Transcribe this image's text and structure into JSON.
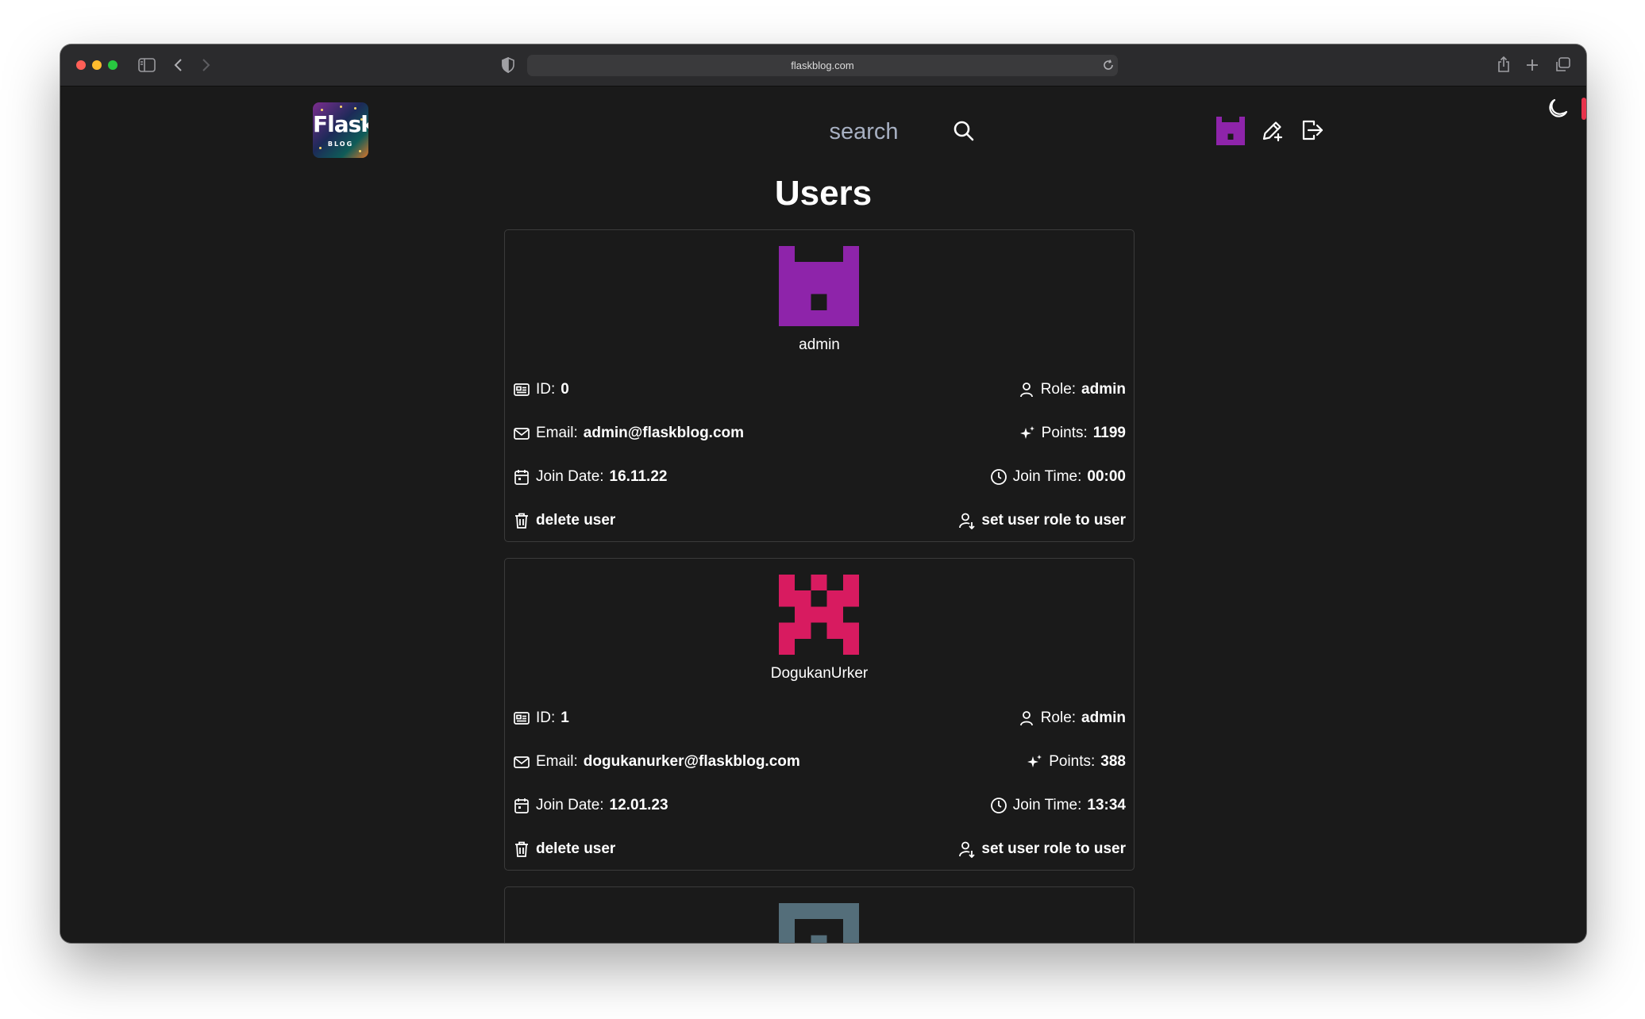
{
  "browser": {
    "url": "flaskblog.com",
    "traffic_lights": [
      "#ff5f57",
      "#febc2e",
      "#28c840"
    ]
  },
  "nav": {
    "logo_text": "Flask",
    "logo_sub": "BLOG",
    "search_placeholder": "search"
  },
  "page": {
    "title": "Users"
  },
  "labels": {
    "id": "ID:",
    "role": "Role:",
    "email": "Email:",
    "points": "Points:",
    "join_date": "Join Date:",
    "join_time": "Join Time:",
    "delete": "delete user",
    "set_role": "set user role to user"
  },
  "users": [
    {
      "name": "admin",
      "id": "0",
      "role": "admin",
      "email": "admin@flaskblog.com",
      "points": "1199",
      "join_date": "16.11.22",
      "join_time": "00:00",
      "avatar_color": "#8e24aa"
    },
    {
      "name": "DogukanUrker",
      "id": "1",
      "role": "admin",
      "email": "dogukanurker@flaskblog.com",
      "points": "388",
      "join_date": "12.01.23",
      "join_time": "13:34",
      "avatar_color": "#d81b60"
    },
    {
      "avatar_color": "#546e7a"
    }
  ],
  "colors": {
    "background": "#1a1a1a",
    "card_border": "#3b3b3b",
    "accent_red": "#e8344c",
    "header_avatar": "#8e24aa"
  }
}
